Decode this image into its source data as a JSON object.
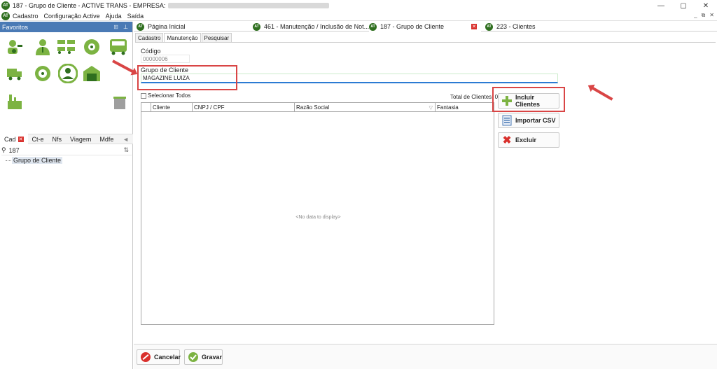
{
  "window": {
    "title": "187 - Grupo de Cliente - ACTIVE TRANS - EMPRESA:",
    "controls": [
      "—",
      "▢",
      "✕"
    ]
  },
  "menu": [
    "Cadastro",
    "Configuração Active",
    "Ajuda",
    "Saída"
  ],
  "mdi_controls": [
    "_",
    "⧉",
    "✕"
  ],
  "sidebar": {
    "title": "Favoritos",
    "tabs": [
      "Cad",
      "Ct-e",
      "Nfs",
      "Viagem",
      "Mdfe"
    ],
    "search_value": "187",
    "tree_item": "Grupo de Cliente"
  },
  "doc_tabs": [
    "Página Inicial",
    "461 - Manutenção / Inclusão de Not...",
    "187 - Grupo de Cliente",
    "223 - Clientes"
  ],
  "inner_tabs": [
    "Cadastro",
    "Manutenção",
    "Pesquisar"
  ],
  "form": {
    "codigo_label": "Código",
    "codigo_value": "00000006",
    "grupo_label": "Grupo de Cliente",
    "grupo_value": "MAGAZINE LUIZA"
  },
  "grid": {
    "select_all": "Selecionar Todos",
    "total_label": "Total de Clientes: 0",
    "columns": [
      "Cliente",
      "CNPJ / CPF",
      "Razão Social",
      "Fantasia"
    ],
    "empty": "<No data to display>"
  },
  "actions": {
    "incluir": "Incluir Clientes",
    "importar": "Importar CSV",
    "excluir": "Excluir"
  },
  "footer": {
    "cancelar": "Cancelar",
    "gravar": "Gravar"
  },
  "colors": {
    "accent_red": "#d94545",
    "favorites_header": "#4a7ab5",
    "icon_green": "#7cb342"
  }
}
